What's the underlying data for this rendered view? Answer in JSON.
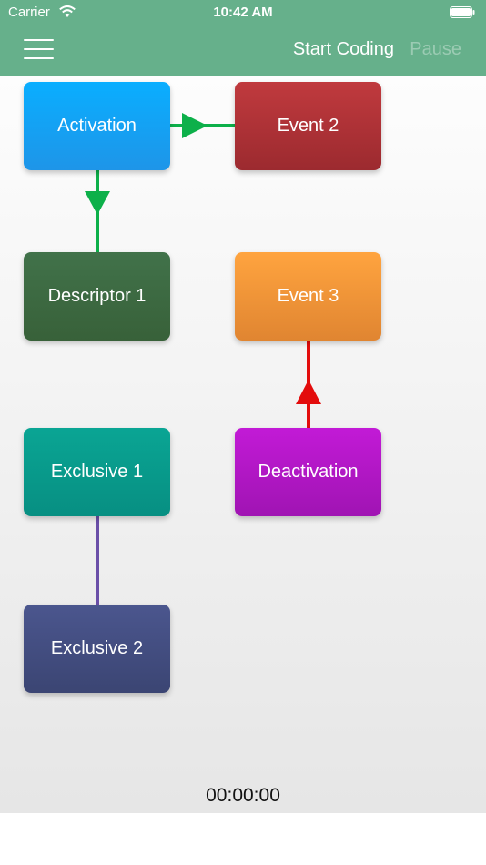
{
  "status_bar": {
    "carrier": "Carrier",
    "time": "10:42 AM"
  },
  "nav": {
    "start_label": "Start Coding",
    "pause_label": "Pause"
  },
  "boxes": {
    "activation": {
      "label": "Activation",
      "color": "#1aa7f5"
    },
    "event2": {
      "label": "Event 2",
      "color": "#b03337"
    },
    "descriptor1": {
      "label": "Descriptor 1",
      "color": "#3e6b41"
    },
    "event3": {
      "label": "Event 3",
      "color": "#f0953a"
    },
    "exclusive1": {
      "label": "Exclusive 1",
      "color": "#0f9f90"
    },
    "deactivation": {
      "label": "Deactivation",
      "color": "#b319c8"
    },
    "exclusive2": {
      "label": "Exclusive 2",
      "color": "#444e80"
    }
  },
  "connector_colors": {
    "green": "#0db04a",
    "red": "#e30c0c",
    "purple": "#6a4fa8"
  },
  "timer": "00:00:00"
}
